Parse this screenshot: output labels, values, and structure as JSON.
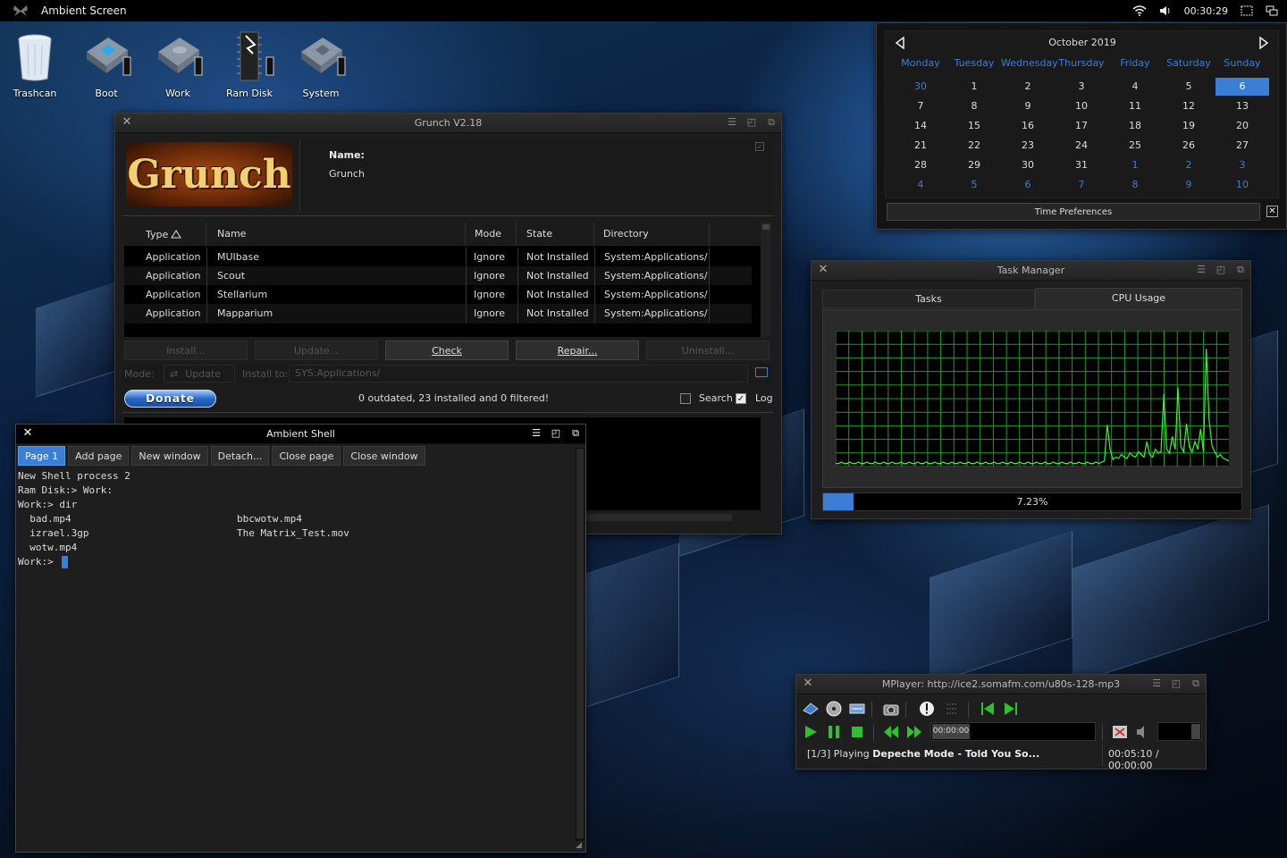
{
  "screen": {
    "title": "Ambient Screen",
    "time": "00:30:29"
  },
  "desktop_icons": [
    {
      "label": "Trashcan",
      "icon": "trashcan-icon"
    },
    {
      "label": "Boot",
      "icon": "drive-icon"
    },
    {
      "label": "Work",
      "icon": "drive-icon"
    },
    {
      "label": "Ram Disk",
      "icon": "ram-disk-icon"
    },
    {
      "label": "System",
      "icon": "drive-icon"
    }
  ],
  "grunch": {
    "title": "Grunch V2.18",
    "logo": "Grunch",
    "name_label": "Name:",
    "name_value": "Grunch",
    "columns": [
      "Type",
      "Name",
      "Mode",
      "State",
      "Directory"
    ],
    "rows": [
      {
        "type": "Application",
        "name": "MUIbase",
        "mode": "Ignore",
        "state": "Not Installed",
        "dir": "System:Applications/"
      },
      {
        "type": "Application",
        "name": "Scout",
        "mode": "Ignore",
        "state": "Not Installed",
        "dir": "System:Applications/"
      },
      {
        "type": "Application",
        "name": "Stellarium",
        "mode": "Ignore",
        "state": "Not Installed",
        "dir": "System:Applications/"
      },
      {
        "type": "Application",
        "name": "Mapparium",
        "mode": "Ignore",
        "state": "Not Installed",
        "dir": "System:Applications/"
      }
    ],
    "buttons": {
      "install": "Install...",
      "update": "Update...",
      "check": "Check",
      "repair": "Repair...",
      "uninstall": "Uninstall..."
    },
    "mode_label": "Mode:",
    "mode_value": "Update",
    "install_to_label": "Install to:",
    "install_to_value": "SYS:Applications/",
    "donate": "Donate",
    "status": "0 outdated, 23 installed and 0 filtered!",
    "search_label": "Search",
    "log_label": "Log"
  },
  "calendar": {
    "month": "October 2019",
    "days": [
      "Monday",
      "Tuesday",
      "Wednesday",
      "Thursday",
      "Friday",
      "Saturday",
      "Sunday"
    ],
    "weeks": [
      [
        "30",
        "1",
        "2",
        "3",
        "4",
        "5",
        "6"
      ],
      [
        "7",
        "8",
        "9",
        "10",
        "11",
        "12",
        "13"
      ],
      [
        "14",
        "15",
        "16",
        "17",
        "18",
        "19",
        "20"
      ],
      [
        "21",
        "22",
        "23",
        "24",
        "25",
        "26",
        "27"
      ],
      [
        "28",
        "29",
        "30",
        "31",
        "1",
        "2",
        "3"
      ],
      [
        "4",
        "5",
        "6",
        "7",
        "8",
        "9",
        "10"
      ]
    ],
    "today": "6",
    "prefs_button": "Time Preferences",
    "colors": {
      "accent": "#3a7fd5"
    }
  },
  "task_manager": {
    "title": "Task Manager",
    "tabs": [
      "Tasks",
      "CPU Usage"
    ],
    "active_tab": "CPU Usage",
    "usage_text": "7.23%",
    "usage_fraction": 0.0723,
    "cpu_history": [
      0.01,
      0.01,
      0.02,
      0.01,
      0.01,
      0.02,
      0.01,
      0.01,
      0.02,
      0.01,
      0.01,
      0.02,
      0.01,
      0.01,
      0.02,
      0.01,
      0.01,
      0.02,
      0.01,
      0.01,
      0.02,
      0.01,
      0.01,
      0.02,
      0.01,
      0.01,
      0.02,
      0.01,
      0.01,
      0.02,
      0.01,
      0.01,
      0.02,
      0.01,
      0.01,
      0.02,
      0.01,
      0.01,
      0.02,
      0.01,
      0.01,
      0.02,
      0.01,
      0.01,
      0.02,
      0.01,
      0.01,
      0.02,
      0.01,
      0.01,
      0.02,
      0.01,
      0.01,
      0.02,
      0.01,
      0.01,
      0.02,
      0.01,
      0.01,
      0.02,
      0.01,
      0.01,
      0.02,
      0.01,
      0.01,
      0.02,
      0.01,
      0.01,
      0.02,
      0.01,
      0.01,
      0.02,
      0.01,
      0.01,
      0.02,
      0.01,
      0.01,
      0.02,
      0.01,
      0.01,
      0.02,
      0.01,
      0.01,
      0.02,
      0.01,
      0.01,
      0.02,
      0.01,
      0.01,
      0.02,
      0.01,
      0.01,
      0.02,
      0.01,
      0.02,
      0.03,
      0.31,
      0.12,
      0.04,
      0.06,
      0.05,
      0.08,
      0.06,
      0.05,
      0.09,
      0.07,
      0.06,
      0.1,
      0.08,
      0.06,
      0.18,
      0.08,
      0.06,
      0.12,
      0.09,
      0.1,
      0.55,
      0.12,
      0.09,
      0.22,
      0.12,
      0.6,
      0.14,
      0.1,
      0.32,
      0.14,
      0.1,
      0.18,
      0.12,
      0.28,
      0.1,
      0.9,
      0.35,
      0.15,
      0.1,
      0.06,
      0.08,
      0.05,
      0.04,
      0.03
    ],
    "colors": {
      "grid": "#1f9a2a",
      "line": "#3ef03a",
      "bar": "#3a7fd5"
    }
  },
  "shell": {
    "title": "Ambient Shell",
    "tabs": [
      "Page 1",
      "Add page",
      "New window",
      "Detach...",
      "Close page",
      "Close window"
    ],
    "lines": [
      "New Shell process 2",
      "Ram Disk:> Work:",
      "Work:> dir",
      "  bad.mp4",
      "  izrael.3gp",
      "  wotw.mp4",
      "Work:> "
    ],
    "col2": [
      "bbcwotw.mp4",
      "The Matrix_Test.mov"
    ]
  },
  "mplayer": {
    "title": "MPlayer: http://ice2.somafm.com/u80s-128-mp3",
    "position": "00:00:00",
    "status_prefix": "[1/3] Playing",
    "status_track": "Depeche Mode - Told You So...",
    "time": "00:05:10 / 00:00:00"
  }
}
